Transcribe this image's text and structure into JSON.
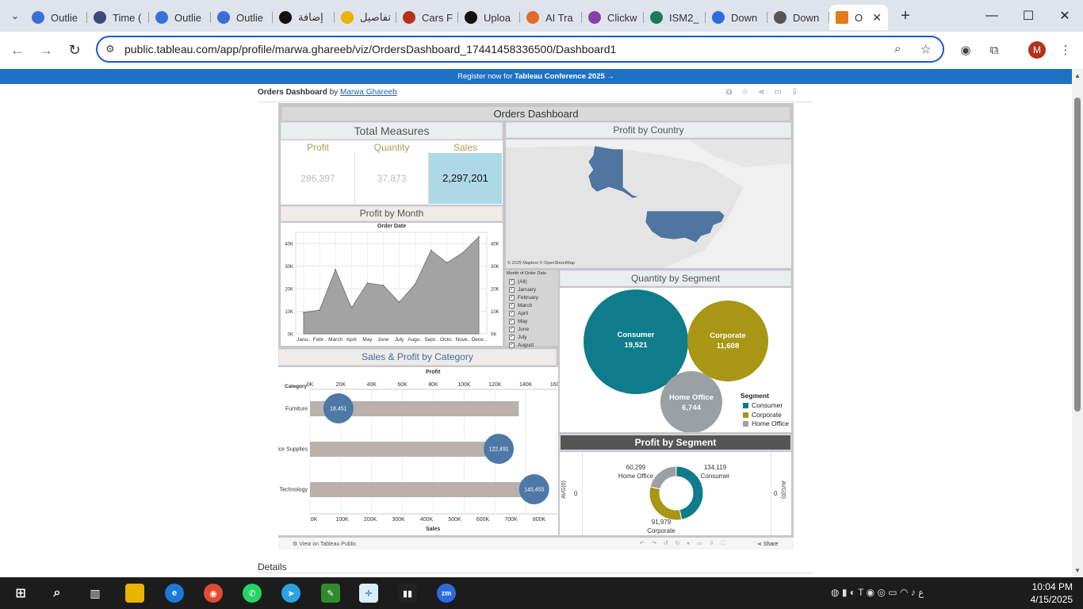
{
  "browser": {
    "tabs": [
      {
        "label": "Outlie",
        "color": "#3b6fd8"
      },
      {
        "label": "Time (",
        "color": "#3b4a7a"
      },
      {
        "label": "Outlie",
        "color": "#3b6fd8"
      },
      {
        "label": "Outlie",
        "color": "#3b6fd8"
      },
      {
        "label": "إضافة",
        "color": "#111111"
      },
      {
        "label": "تفاصيل",
        "color": "#e8b400"
      },
      {
        "label": "Cars F",
        "color": "#b5321c"
      },
      {
        "label": "Uploa",
        "color": "#111111"
      },
      {
        "label": "AI Tra",
        "color": "#e06a2a"
      },
      {
        "label": "Clickw",
        "color": "#8a3fa8"
      },
      {
        "label": "ISM2_",
        "color": "#1d7a5c"
      },
      {
        "label": "Down",
        "color": "#2d6be0"
      },
      {
        "label": "Down",
        "color": "#555555"
      }
    ],
    "active_tab": {
      "label": "O",
      "color": "#e27d1a"
    },
    "url": "public.tableau.com/app/profile/marwa.ghareeb/viz/OrdersDashboard_17441458336500/Dashboard1",
    "profile_initial": "M"
  },
  "banner": {
    "prefix": "Register now for ",
    "bold": "Tableau Conference 2025",
    "suffix": " →"
  },
  "page": {
    "viz_name": "Orders Dashboard",
    "by": "by",
    "author": "Marwa Ghareeb",
    "details": "Details",
    "view_on": "View on Tableau Public",
    "share": "Share"
  },
  "dashboard": {
    "title": "Orders Dashboard",
    "total_measures": {
      "title": "Total Measures",
      "headers": [
        "Profit",
        "Quantity",
        "Sales"
      ],
      "values": [
        "286,397",
        "37,873",
        "2,297,201"
      ]
    },
    "profit_by_country": {
      "title": "Profit by Country",
      "attribution": "© 2025 Mapbox © OpenStreetMap"
    },
    "profit_by_month": {
      "title": "Profit by Month",
      "axis_title": "Order Date"
    },
    "month_filter": {
      "title": "Month of Order Date",
      "items": [
        "(All)",
        "January",
        "February",
        "March",
        "April",
        "May",
        "June",
        "July",
        "August"
      ]
    },
    "quantity_by_segment": {
      "title": "Quantity by Segment",
      "legend_title": "Segment"
    },
    "sales_profit_category": {
      "title": "Sales & Profit by Category",
      "top_axis": "Profit",
      "bottom_axis": "Sales",
      "row_header": "Category"
    },
    "profit_by_segment": {
      "title": "Profit by Segment",
      "left_axis": "AVG(0)",
      "right_axis": "AVG(0)",
      "zero": "0"
    }
  },
  "chart_data": [
    {
      "type": "area",
      "title": "Profit by Month",
      "xlabel": "Order Date",
      "ylabel": "",
      "categories": [
        "Janu..",
        "Febr..",
        "March",
        "April",
        "May",
        "June",
        "July",
        "Augu..",
        "Sept..",
        "Octo..",
        "Nove..",
        "Dece.."
      ],
      "values": [
        9500,
        10500,
        28500,
        11500,
        22500,
        21500,
        14000,
        22000,
        37000,
        31500,
        36000,
        43000
      ],
      "ylim": [
        0,
        45000
      ],
      "yticks": [
        "0K",
        "10K",
        "20K",
        "30K",
        "40K"
      ],
      "grid": true
    },
    {
      "type": "bar",
      "title": "Sales & Profit by Category",
      "categories": [
        "Furniture",
        "Office Supplies",
        "Technology"
      ],
      "series": [
        {
          "name": "Sales",
          "values": [
            741999,
            719047,
            836154
          ]
        },
        {
          "name": "Profit",
          "values": [
            18451,
            122491,
            145455
          ]
        }
      ],
      "profit_ticks": [
        "0K",
        "20K",
        "40K",
        "60K",
        "80K",
        "100K",
        "120K",
        "140K",
        "160K"
      ],
      "sales_ticks": [
        "0K",
        "100K",
        "200K",
        "300K",
        "400K",
        "500K",
        "600K",
        "700K",
        "800K"
      ],
      "profit_labels": [
        "18,451",
        "122,491",
        "145,455"
      ]
    },
    {
      "type": "bubble",
      "title": "Quantity by Segment",
      "categories": [
        "Consumer",
        "Corporate",
        "Home Office"
      ],
      "values": [
        19521,
        11608,
        6744
      ],
      "labels": [
        "19,521",
        "11,608",
        "6,744"
      ],
      "colors": [
        "#0e7c8a",
        "#a89614",
        "#9aa0a3"
      ],
      "legend": "right-bottom"
    },
    {
      "type": "pie",
      "title": "Profit by Segment",
      "categories": [
        "Consumer",
        "Corporate",
        "Home Office"
      ],
      "values": [
        134119,
        91979,
        60299
      ],
      "labels": [
        "134,119",
        "91,979",
        "60,299"
      ],
      "colors": [
        "#0e7c8a",
        "#a89614",
        "#9aa0a3"
      ]
    }
  ],
  "taskbar": {
    "time": "10:04 PM",
    "date": "4/15/2025"
  }
}
